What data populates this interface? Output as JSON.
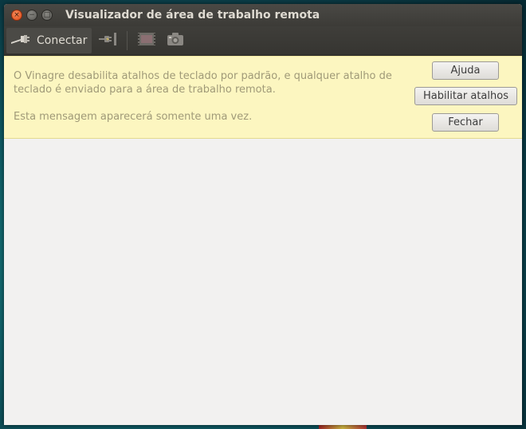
{
  "window": {
    "title": "Visualizador de área de trabalho remota",
    "buttons": {
      "close": "×",
      "minimize": "−",
      "maximize": "□"
    }
  },
  "toolbar": {
    "connect_label": "Conectar",
    "icons": [
      "connect-icon",
      "disconnect-icon",
      "fullscreen-icon",
      "screenshot-icon"
    ]
  },
  "infobar": {
    "message_line": "O Vinagre desabilita atalhos de teclado por padrão, e qualquer atalho de teclado é enviado para a área de trabalho remota.",
    "message_note": "Esta mensagem aparecerá somente uma vez.",
    "help_label": "Ajuda",
    "enable_label": "Habilitar atalhos",
    "close_label": "Fechar",
    "background_color": "#fcf6c0"
  },
  "colors": {
    "titlebar": "#3c3b37",
    "toolbar": "#3a3935",
    "content": "#f2f1f0",
    "close_button": "#df4a16"
  }
}
